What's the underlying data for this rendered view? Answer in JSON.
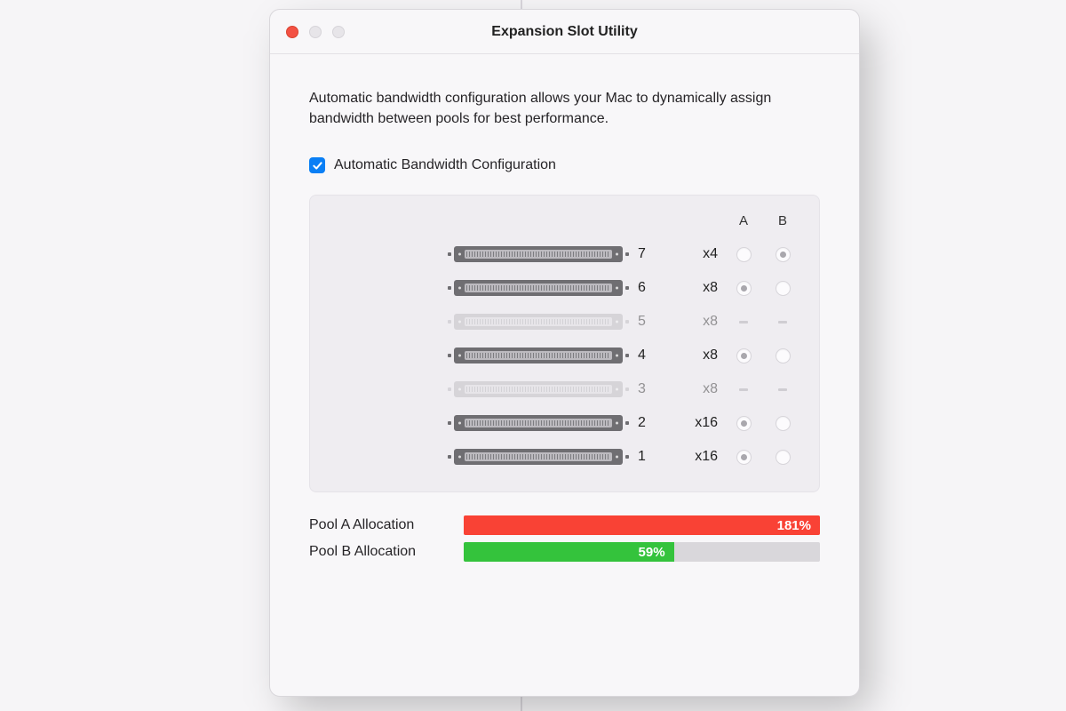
{
  "window": {
    "title": "Expansion Slot Utility"
  },
  "description": "Automatic bandwidth configuration allows your Mac to dynamically assign bandwidth between pools for best performance.",
  "checkbox": {
    "label": "Automatic Bandwidth Configuration",
    "checked": true
  },
  "columns": {
    "a": "A",
    "b": "B"
  },
  "slots": [
    {
      "num": "7",
      "speed": "x4",
      "enabled": true,
      "a": "unselected",
      "b": "selected"
    },
    {
      "num": "6",
      "speed": "x8",
      "enabled": true,
      "a": "selected",
      "b": "unselected"
    },
    {
      "num": "5",
      "speed": "x8",
      "enabled": false,
      "a": "dash",
      "b": "dash"
    },
    {
      "num": "4",
      "speed": "x8",
      "enabled": true,
      "a": "selected",
      "b": "unselected"
    },
    {
      "num": "3",
      "speed": "x8",
      "enabled": false,
      "a": "dash",
      "b": "dash"
    },
    {
      "num": "2",
      "speed": "x16",
      "enabled": true,
      "a": "selected",
      "b": "unselected"
    },
    {
      "num": "1",
      "speed": "x16",
      "enabled": true,
      "a": "selected",
      "b": "unselected"
    }
  ],
  "pools": {
    "a": {
      "label": "Pool A Allocation",
      "percent_text": "181%",
      "fill_width": "100%",
      "color": "#f94235"
    },
    "b": {
      "label": "Pool B Allocation",
      "percent_text": "59%",
      "fill_width": "59%",
      "color": "#34c33c"
    }
  }
}
